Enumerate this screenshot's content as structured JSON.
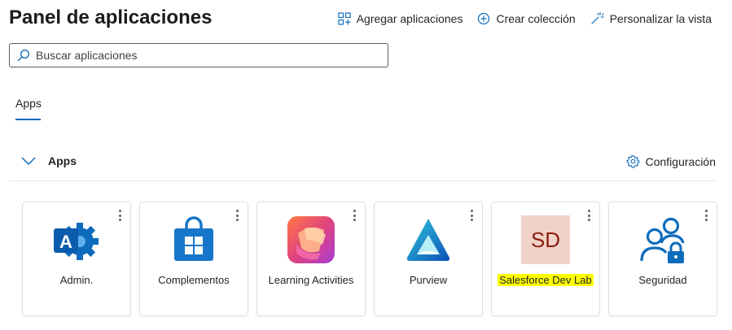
{
  "header": {
    "title": "Panel de aplicaciones",
    "actions": [
      {
        "label": "Agregar aplicaciones",
        "icon": "grid-add-icon"
      },
      {
        "label": "Crear colección",
        "icon": "circle-add-icon"
      },
      {
        "label": "Personalizar la vista",
        "icon": "magic-wand-icon"
      }
    ]
  },
  "search": {
    "placeholder": "Buscar aplicaciones",
    "value": ""
  },
  "tabs": [
    {
      "label": "Apps",
      "selected": true
    }
  ],
  "section": {
    "title": "Apps",
    "expanded": true,
    "config_label": "Configuración"
  },
  "apps": [
    {
      "label": "Admin.",
      "icon": "admin-app-icon"
    },
    {
      "label": "Complementos",
      "icon": "store-bag-icon"
    },
    {
      "label": "Learning Activities",
      "icon": "learning-activities-icon"
    },
    {
      "label": "Purview",
      "icon": "purview-icon"
    },
    {
      "label": "Salesforce Dev Lab",
      "icon": "sd-avatar-icon",
      "initials": "SD",
      "highlighted": true
    },
    {
      "label": "Seguridad",
      "icon": "security-people-icon"
    }
  ],
  "colors": {
    "accent": "#0f6cbd",
    "highlight": "#ffff00",
    "sd_background": "#f1d2c9",
    "sd_text": "#8a1f10"
  }
}
